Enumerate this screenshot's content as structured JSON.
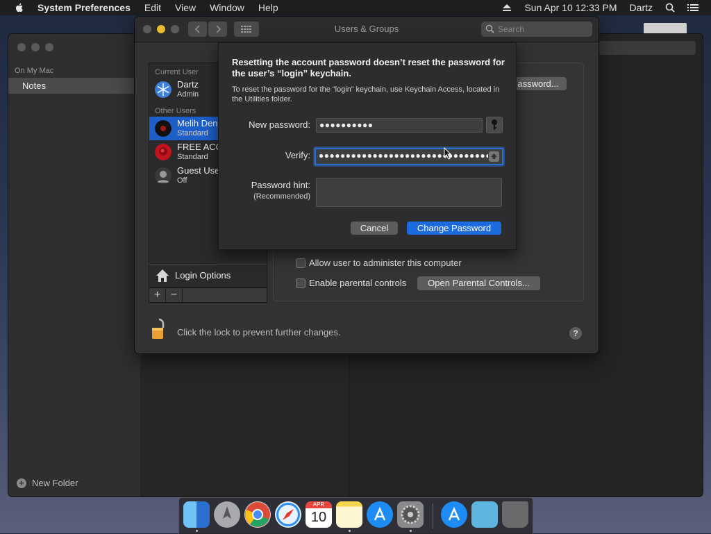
{
  "menubar": {
    "app": "System Preferences",
    "menus": [
      "Edit",
      "View",
      "Window",
      "Help"
    ],
    "datetime": "Sun Apr 10  12:33 PM",
    "user": "Dartz",
    "icons": [
      "apple-icon",
      "eject-icon",
      "spotlight-icon",
      "list-icon"
    ]
  },
  "notes": {
    "section": "On My Mac",
    "folder": "Notes",
    "new_folder": "New Folder"
  },
  "sysprefs": {
    "title": "Users & Groups",
    "search_placeholder": "Search",
    "current_user_label": "Current User",
    "other_users_label": "Other Users",
    "users": [
      {
        "name": "Dartz",
        "role": "Admin"
      },
      {
        "name": "Melih Den",
        "role": "Standard"
      },
      {
        "name": "FREE ACC",
        "role": "Standard"
      },
      {
        "name": "Guest Use",
        "role": "Off"
      }
    ],
    "login_options": "Login Options",
    "add": "+",
    "remove": "−",
    "change_password_partial": "assword...",
    "allow_admin": "Allow user to administer this computer",
    "parental": "Enable parental controls",
    "open_parental": "Open Parental Controls...",
    "lock_text": "Click the lock to prevent further changes.",
    "help": "?"
  },
  "sheet": {
    "heading": "Resetting the account password doesn’t reset the password for the user’s “login” keychain.",
    "info": "To reset the password for the “login” keychain, use Keychain Access, located in the Utilities folder.",
    "new_password_label": "New password:",
    "new_password_value": "●●●●●●●●●●",
    "verify_label": "Verify:",
    "verify_value": "●●●●●●●●●●●●●●●●●●●●●●●●●●●●●●●●●",
    "hint_label": "Password hint:",
    "hint_sub": "(Recommended)",
    "cancel": "Cancel",
    "change": "Change Password"
  },
  "dock": {
    "apps": [
      "Finder",
      "Launchpad",
      "Chrome",
      "Safari",
      "Calendar",
      "Notes",
      "App Store",
      "System Preferences",
      "Downloads",
      "Documents",
      "Trash"
    ],
    "calendar_month": "APR",
    "calendar_day": "10"
  },
  "colors": {
    "accent": "#1e6be0",
    "selection": "#1d5fc9"
  }
}
